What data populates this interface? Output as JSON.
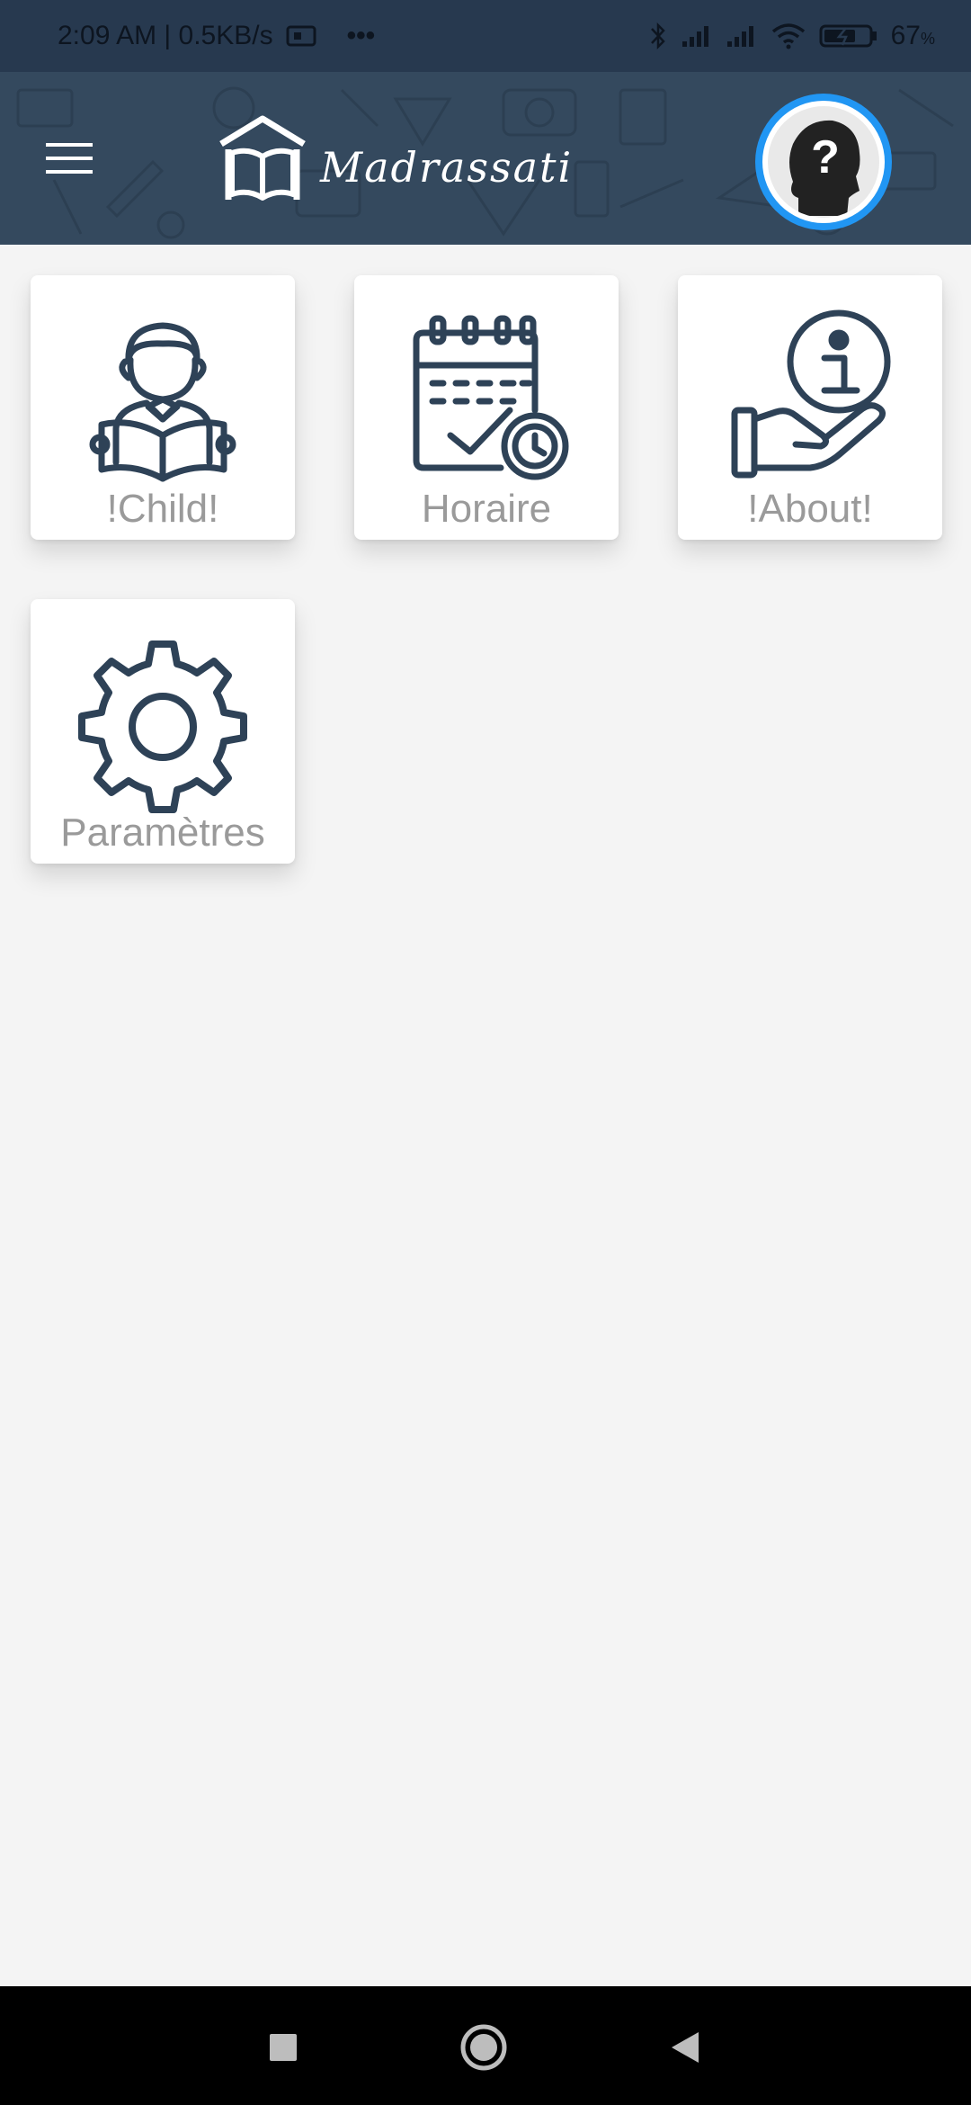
{
  "status_bar": {
    "time_info": "2:09 AM | 0.5KB/s",
    "more_dots": "•••",
    "battery": "67",
    "battery_unit": "%"
  },
  "app_bar": {
    "title": "Madrassati",
    "menu_icon": "hamburger-menu-icon",
    "avatar_icon": "unknown-user-icon",
    "avatar_ring_color": "#2196f3",
    "background_color": "#34495e"
  },
  "tiles": [
    {
      "label": "!Child!",
      "icon": "student-reading-icon"
    },
    {
      "label": "Horaire",
      "icon": "calendar-clock-icon"
    },
    {
      "label": "!About!",
      "icon": "hand-info-icon"
    },
    {
      "label": "Paramètres",
      "icon": "gear-icon"
    }
  ],
  "nav_bar": {
    "recents_icon": "square-icon",
    "home_icon": "circle-icon",
    "back_icon": "triangle-back-icon"
  },
  "colors": {
    "icon_stroke": "#2e4257",
    "label_text": "#9a9a9a",
    "page_background": "#f4f4f4"
  }
}
